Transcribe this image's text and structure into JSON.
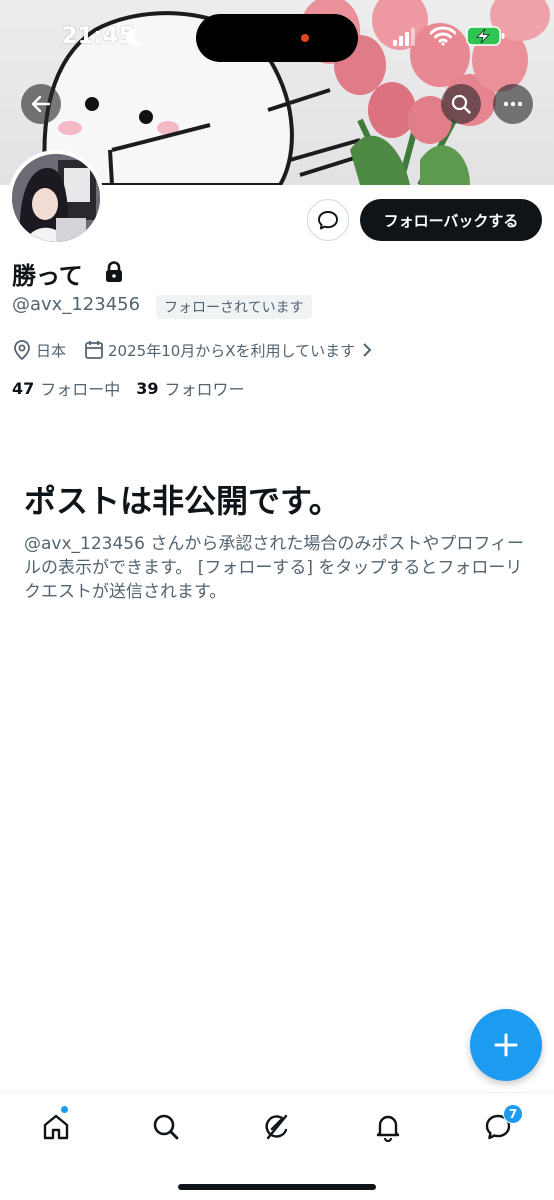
{
  "status_bar": {
    "time": "21:45"
  },
  "profile": {
    "name": "勝って",
    "handle": "@avx_123456",
    "follows_you_badge": "フォローされています",
    "location": "日本",
    "joined": "2025年10月からXを利用しています",
    "following_count": "47",
    "following_label": "フォロー中",
    "followers_count": "39",
    "followers_label": "フォロワー",
    "follow_back_label": "フォローバックする"
  },
  "private_notice": {
    "title": "ポストは非公開です。",
    "description": "@avx_123456 さんから承認された場合のみポストやプロフィールの表示ができます。 [フォローする] をタップするとフォローリクエストが送信されます。"
  },
  "tabbar": {
    "items": [
      "home-icon",
      "search-icon",
      "grok-icon",
      "notifications-icon",
      "messages-icon"
    ],
    "messages_badge": "7"
  },
  "colors": {
    "accent": "#1d9bf0",
    "text": "#0f1419",
    "muted": "#536471"
  }
}
